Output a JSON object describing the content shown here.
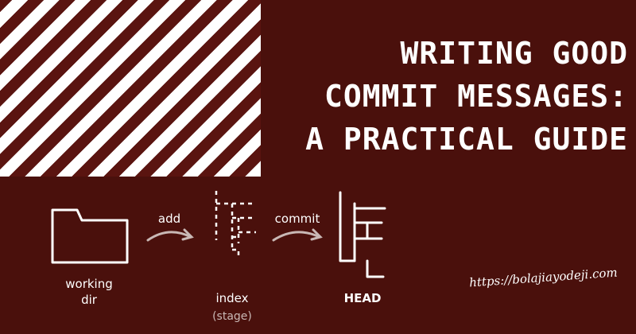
{
  "banner": {
    "title_lines": [
      "WRITING GOOD",
      "COMMIT MESSAGES:",
      "A PRACTICAL GUIDE"
    ],
    "url": "https://bolajiayodeji.com"
  },
  "diagram": {
    "working_dir": [
      "working",
      "dir"
    ],
    "add_label": "add",
    "index_label": "index",
    "stage_label": "(stage)",
    "commit_label": "commit",
    "head_label": "HEAD"
  },
  "colors": {
    "background": "#4a100c",
    "stripe_dark": "#5a1410",
    "ink": "#ffffff",
    "muted": "#c9b8b5"
  }
}
